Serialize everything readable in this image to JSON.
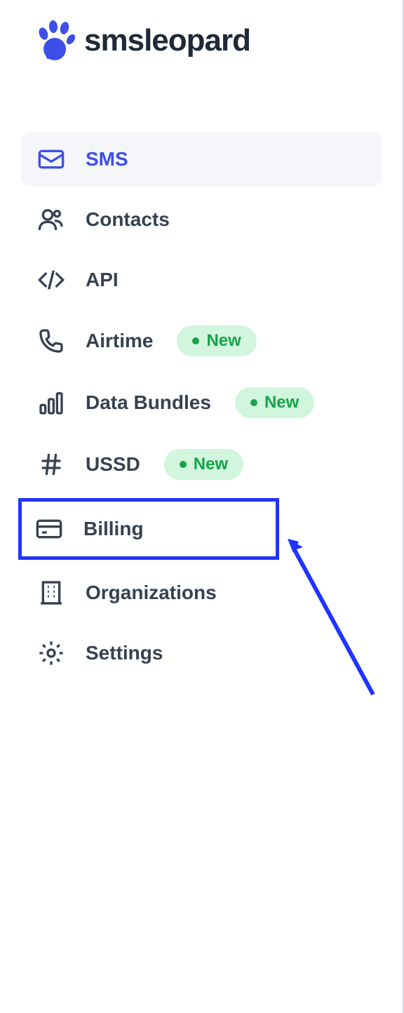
{
  "brand": {
    "name": "smsleopard"
  },
  "sidebar": {
    "items": [
      {
        "label": "SMS",
        "active": true,
        "badge": null
      },
      {
        "label": "Contacts",
        "active": false,
        "badge": null
      },
      {
        "label": "API",
        "active": false,
        "badge": null
      },
      {
        "label": "Airtime",
        "active": false,
        "badge": "New"
      },
      {
        "label": "Data Bundles",
        "active": false,
        "badge": "New"
      },
      {
        "label": "USSD",
        "active": false,
        "badge": "New"
      },
      {
        "label": "Billing",
        "active": false,
        "badge": null,
        "highlighted": true
      },
      {
        "label": "Organizations",
        "active": false,
        "badge": null
      },
      {
        "label": "Settings",
        "active": false,
        "badge": null
      }
    ]
  },
  "annotation": {
    "type": "arrow",
    "target": "billing"
  }
}
